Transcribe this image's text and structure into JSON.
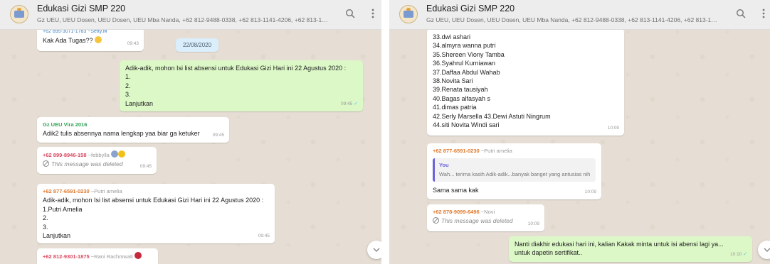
{
  "left": {
    "header": {
      "title": "Edukasi Gizi SMP 220",
      "subtitle": "Gz UEU, UEU Dosen, UEU Dosen, UEU Mba Nanda, +62 812-9488-0338, +62 813-1141-4206, +62 813-1985-...",
      "search_icon": "search-icon",
      "menu_icon": "kebab-menu-icon"
    },
    "messages": {
      "m1": {
        "sender_partial": "+62 895-3071-1783 ~Setty.M",
        "text": "Kak Ada Tugas??",
        "time": "09:43"
      },
      "date_chip": "22/08/2020",
      "m2": {
        "lines": [
          "Adik-adik, mohon Isi list absensi untuk Edukasi Gizi Hari ini 22 Agustus 2020 :",
          "1.",
          "2.",
          "3.",
          "Lanjutkan"
        ],
        "time": "09:45",
        "status": "✓"
      },
      "m3": {
        "sender": "Gz UEU Vira 2016",
        "text": "Adik2 tulis absennya nama lengkap yaa biar ga ketuker",
        "time": "09:45"
      },
      "m4": {
        "sender": "+62 899-8946-158",
        "alias": "~febbylla",
        "deleted": "This message was deleted",
        "time": "09:45"
      },
      "m5": {
        "sender": "+62 877-6591-0230",
        "alias": "~Putri amelia",
        "lines": [
          "Adik-adik, mohon Isi list absensi untuk Edukasi Gizi Hari ini 22 Agustus 2020 :",
          "1.Putri Amelia",
          "2.",
          "3.",
          "Lanjutkan"
        ],
        "time": "09:45"
      },
      "m6": {
        "sender": "+62 812-9301-1875",
        "alias": "~Rani Rachmwati"
      }
    }
  },
  "right": {
    "header": {
      "title": "Edukasi Gizi SMP 220",
      "subtitle": "Gz UEU, UEU Dosen, UEU Dosen, UEU Mba Nanda, +62 812-9488-0338, +62 813-1141-4206, +62 813-1985-..."
    },
    "messages": {
      "list": {
        "lines": [
          "33.dwi ashari",
          "34.almyra wanna putri",
          "35.Shereen Viony Tamba",
          "36.Syahrul Kurniawan",
          "37.Daffaa Abdul Wahab",
          "38.Novita Sari",
          "39.Renata tausiyah",
          "40.Bagas alfasyah s",
          "41.dimas patria",
          "42.Serly Marsella 43.Dewi Astuti Ningrum",
          "44.siti Novita Windi sari"
        ],
        "time": "10:09"
      },
      "r2": {
        "sender": "+62 877-6591-0230",
        "alias": "~Putri amelia",
        "quote_name": "You",
        "quote_text": "Wah... terima kasih Adik-adik...banyak banget yang antusias nih",
        "text": "Sama sama kak",
        "time": "10:09"
      },
      "r3": {
        "sender": "+62 878-9099-6496",
        "alias": "~Novi",
        "deleted": "This message was deleted",
        "time": "10:09"
      },
      "r4": {
        "lines": [
          "Nanti diakhir edukasi hari ini, kalian Kakak minta untuk isi abensi lagi ya...",
          "untuk dapetin sertifikat.."
        ],
        "time": "10:10",
        "status": "✓"
      }
    }
  },
  "colors": {
    "chat_bg": "#e6ded4",
    "outgoing_bubble": "#dcf8c6",
    "sender_green": "#35a35a",
    "sender_pink": "#d9485f",
    "sender_orange": "#e07a2e",
    "quote_accent": "#6b63d8"
  }
}
